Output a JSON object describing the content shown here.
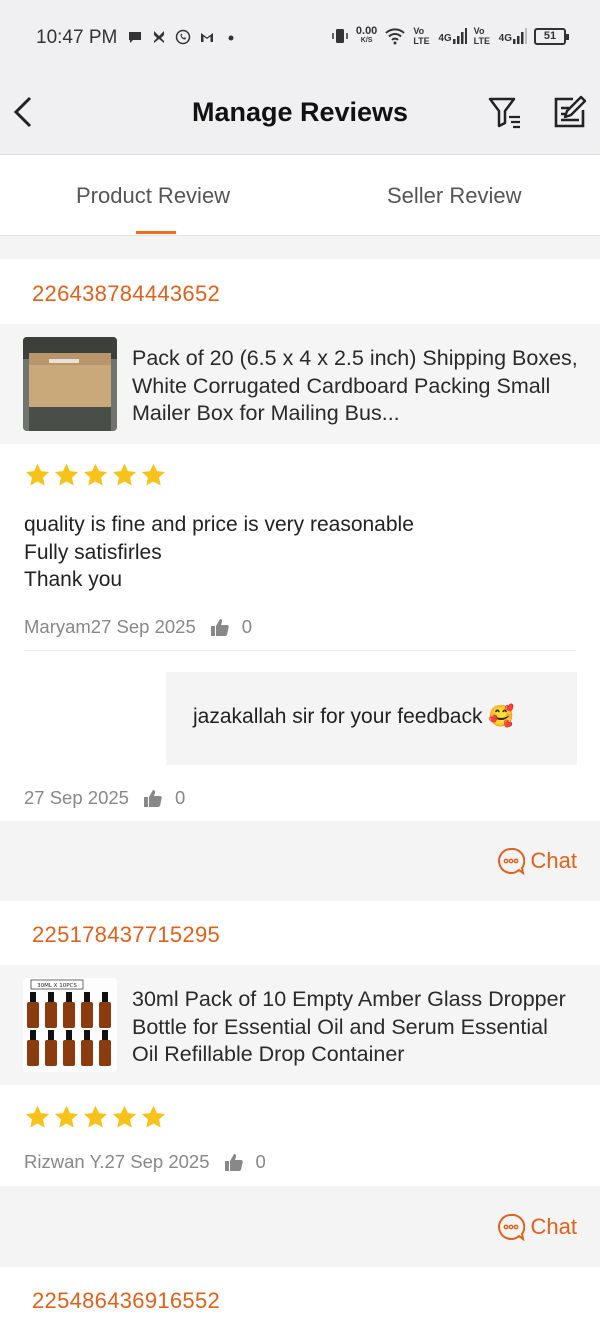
{
  "status_bar": {
    "time": "10:47 PM",
    "net_speed": "0.00",
    "net_unit": "K/S",
    "volte1": "Vo LTE",
    "signal1": "4G",
    "volte2": "Vo LTE",
    "signal2": "4G",
    "battery": "51"
  },
  "header": {
    "title": "Manage Reviews",
    "back_icon": "back-arrow-icon",
    "filter_icon": "filter-icon",
    "edit_icon": "edit-icon"
  },
  "tabs": [
    {
      "label": "Product Review",
      "active": true
    },
    {
      "label": "Seller Review",
      "active": false
    }
  ],
  "accent_color": "#e2611a",
  "reviews": [
    {
      "order_id": "226438784443652",
      "product_title": "Pack of 20 (6.5 x 4 x 2.5 inch) Shipping Boxes, White Corrugated Cardboard Packing Small Mailer Box for Mailing Bus...",
      "rating": 5,
      "text": "quality is fine  and price is very reasonable\nFully satisfirles\nThank you",
      "author_date": "Maryam27 Sep 2025",
      "likes": "0",
      "reply": {
        "text": "jazakallah sir for your feedback 🥰",
        "date": "27 Sep 2025",
        "likes": "0"
      },
      "chat_label": "Chat"
    },
    {
      "order_id": "225178437715295",
      "product_title": "30ml Pack of 10 Empty Amber Glass Dropper Bottle for Essential Oil and Serum Essential Oil Refillable Drop Container",
      "thumb_label": "30ML X 10PCS",
      "rating": 5,
      "author_date": "Rizwan Y.27 Sep 2025",
      "likes": "0",
      "chat_label": "Chat"
    },
    {
      "order_id": "225486436916552"
    }
  ]
}
